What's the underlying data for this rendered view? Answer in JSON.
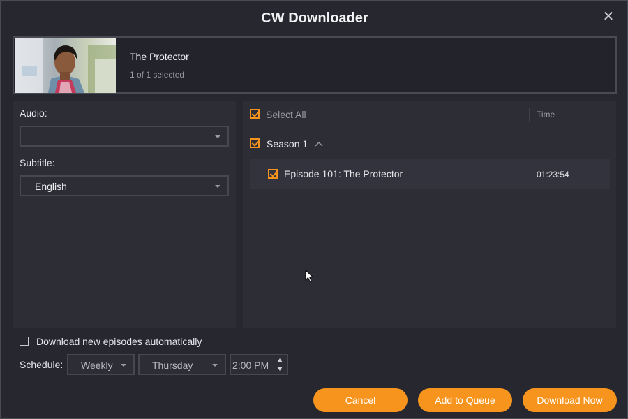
{
  "window": {
    "title": "CW Downloader",
    "close_glyph": "✕"
  },
  "header": {
    "show_title": "The Protector",
    "selection_text": "1 of 1 selected"
  },
  "left_panel": {
    "audio_label": "Audio:",
    "audio_value": "",
    "subtitle_label": "Subtitle:",
    "subtitle_value": "English"
  },
  "episode_list": {
    "select_all_label": "Select All",
    "select_all_checked": true,
    "time_column_label": "Time",
    "seasons": [
      {
        "label": "Season 1",
        "checked": true,
        "expanded": true,
        "episodes": [
          {
            "title": "Episode 101: The Protector",
            "time": "01:23:54",
            "checked": true
          }
        ]
      }
    ]
  },
  "auto_download": {
    "label": "Download new episodes automatically",
    "checked": false
  },
  "schedule": {
    "label": "Schedule:",
    "frequency": "Weekly",
    "day": "Thursday",
    "time": "2:00 PM"
  },
  "buttons": {
    "cancel": "Cancel",
    "add_to_queue": "Add to Queue",
    "download_now": "Download Now"
  },
  "colors": {
    "accent": "#f7941d",
    "background": "#27272f",
    "panel": "#2d2d36"
  },
  "icons": {
    "close": "close-icon",
    "caret": "chevron-down-icon",
    "collapse": "chevron-up-icon",
    "checkbox": "checkbox-checked-icon"
  }
}
